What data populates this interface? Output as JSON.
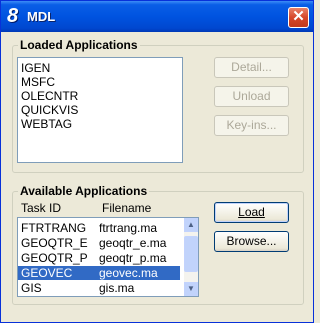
{
  "window": {
    "title": "MDL",
    "app_icon_glyph": "8",
    "close_glyph": "✕"
  },
  "loaded": {
    "label": "Loaded Applications",
    "items": [
      "IGEN",
      "MSFC",
      "OLECNTR",
      "QUICKVIS",
      "WEBTAG"
    ],
    "buttons": {
      "detail": "Detail...",
      "unload": "Unload",
      "keyins": "Key-ins..."
    }
  },
  "available": {
    "label": "Available Applications",
    "col_task": "Task ID",
    "col_file": "Filename",
    "rows": [
      {
        "task": "FTRTRANG",
        "file": "ftrtrang.ma",
        "selected": false
      },
      {
        "task": "GEOQTR_E",
        "file": "geoqtr_e.ma",
        "selected": false
      },
      {
        "task": "GEOQTR_P",
        "file": "geoqtr_p.ma",
        "selected": false
      },
      {
        "task": "GEOVEC",
        "file": "geovec.ma",
        "selected": true
      },
      {
        "task": "GIS",
        "file": "gis.ma",
        "selected": false
      }
    ],
    "buttons": {
      "load": "Load",
      "browse": "Browse..."
    },
    "scroll_up_glyph": "▲",
    "scroll_down_glyph": "▼"
  },
  "colors": {
    "selection": "#316ac5",
    "title_bar": "#0053e0"
  }
}
